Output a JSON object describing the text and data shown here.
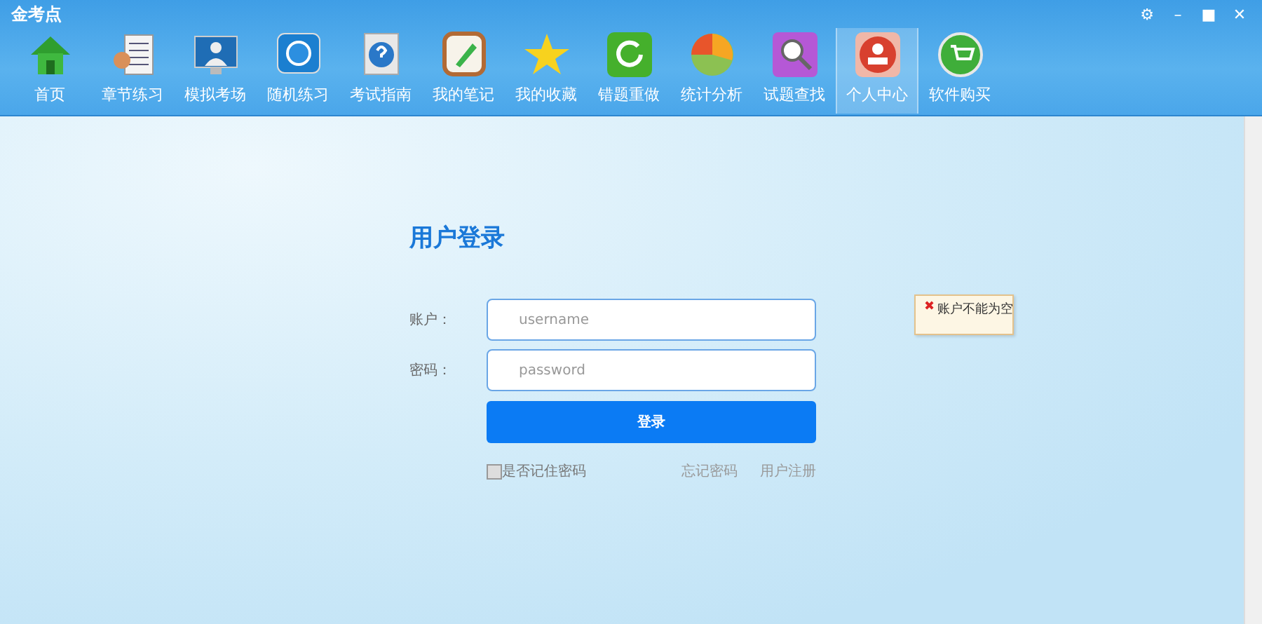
{
  "window": {
    "title": "金考点",
    "controls": [
      "⚙",
      "–",
      "■",
      "✕"
    ]
  },
  "toolbar": [
    {
      "label": "首页",
      "selected": false
    },
    {
      "label": "章节练习",
      "selected": false
    },
    {
      "label": "模拟考场",
      "selected": false
    },
    {
      "label": "随机练习",
      "selected": false
    },
    {
      "label": "考试指南",
      "selected": false
    },
    {
      "label": "我的笔记",
      "selected": false
    },
    {
      "label": "我的收藏",
      "selected": false
    },
    {
      "label": "错题重做",
      "selected": false
    },
    {
      "label": "统计分析",
      "selected": false
    },
    {
      "label": "试题查找",
      "selected": false
    },
    {
      "label": "个人中心",
      "selected": true
    },
    {
      "label": "软件购买",
      "selected": false
    }
  ],
  "login": {
    "title": "用户登录",
    "fields": [
      {
        "label": "账户：",
        "placeholder": "username"
      },
      {
        "label": "密码：",
        "placeholder": "password"
      }
    ],
    "submit": "登录",
    "remember": {
      "label": "是否记住密码",
      "checked": false
    },
    "links": [
      "忘记密码",
      "用户注册"
    ],
    "error": {
      "icon": "✖",
      "text": "账户不能为空"
    }
  }
}
